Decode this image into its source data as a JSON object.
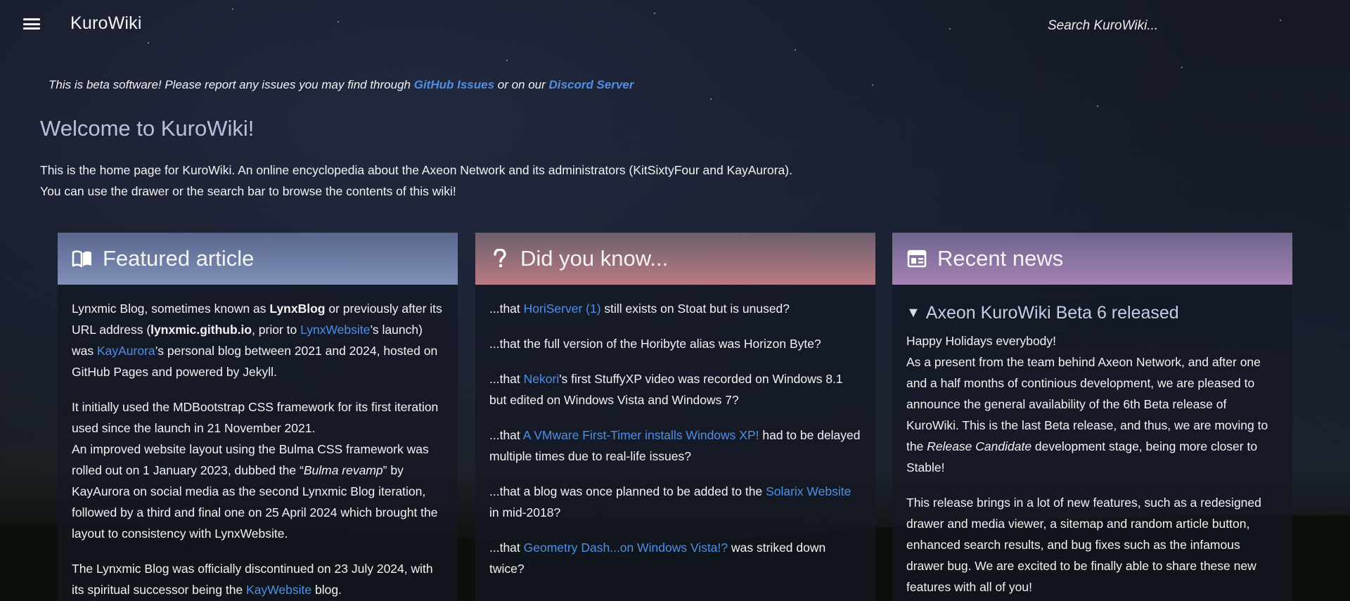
{
  "header": {
    "site_title": "KuroWiki",
    "search_placeholder": "Search KuroWiki..."
  },
  "beta_note": {
    "text_before": "This is beta software! Please report any issues you may find through ",
    "link1": "GitHub Issues",
    "text_middle": " or on our ",
    "link2": "Discord Server"
  },
  "welcome": {
    "title": "Welcome to KuroWiki!",
    "line1": "This is the home page for KuroWiki. An online encyclopedia about the Axeon Network and its administrators (KitSixtyFour and KayAurora).",
    "line2": "You can use the drawer or the search bar to browse the contents of this wiki!"
  },
  "featured": {
    "title": "Featured article",
    "icon": "book-open-icon",
    "p1": {
      "a": "Lynxmic Blog, sometimes known as ",
      "b_bold": "LynxBlog",
      "c": " or previously after its URL address (",
      "d_bold": "lynxmic.github.io",
      "e": ", prior to ",
      "f_link": "LynxWebsite",
      "g": "’s launch) was ",
      "h_link": "KayAurora",
      "i": "’s personal blog between 2021 and 2024, hosted on GitHub Pages and powered by Jekyll."
    },
    "p2": {
      "a": "It initially used the MDBootstrap CSS framework for its first iteration used since the launch in 21 November 2021.",
      "b": "An improved website layout using the Bulma CSS framework was rolled out on 1 January 2023, dubbed the “",
      "c_italic": "Bulma revamp",
      "d": "” by KayAurora on social media as the second Lynxmic Blog iteration, followed by a third and final one on 25 April 2024 which brought the layout to consistency with LynxWebsite."
    },
    "p3": {
      "a": "The Lynxmic Blog was officially discontinued on 23 July 2024, with its spiritual successor being the ",
      "b_link": "KayWebsite",
      "c": " blog."
    }
  },
  "didyouknow": {
    "title": "Did you know...",
    "icon": "question-mark-icon",
    "items": [
      {
        "pre": "...that ",
        "link": "HoriServer (1)",
        "post": " still exists on Stoat but is unused?"
      },
      {
        "pre": "...that the full version of the Horibyte alias was Horizon Byte?",
        "link": "",
        "post": ""
      },
      {
        "pre": "...that ",
        "link": "Nekori",
        "post": "'s first StuffyXP video was recorded on Windows 8.1 but edited on Windows Vista and Windows 7?"
      },
      {
        "pre": "...that ",
        "link": "A VMware First-Timer installs Windows XP!",
        "post": " had to be delayed multiple times due to real-life issues?"
      },
      {
        "pre": "...that a blog was once planned to be added to the ",
        "link": "Solarix Website",
        "post": " in mid-2018?"
      },
      {
        "pre": "...that ",
        "link": "Geometry Dash...on Windows Vista!?",
        "post": " was striked down twice?"
      }
    ]
  },
  "news": {
    "title": "Recent news",
    "icon": "newspaper-icon",
    "item_title": "Axeon KuroWiki Beta 6 released",
    "toggle_icon": "triangle-down-icon",
    "greeting": "Happy Holidays everybody!",
    "p1": {
      "a": "As a present from the team behind Axeon Network, and after one and a half months of continious development, we are pleased to announce the general availability of the 6th Beta release of KuroWiki. This is the last Beta release, and thus, we are moving to the ",
      "b_italic": "Release Candidate",
      "c": " development stage, being more closer to Stable!"
    },
    "p2": "This release brings in a lot of new features, such as a redesigned drawer and media viewer, a sitemap and random article button, enhanced search results, and bug fixes such as the infamous drawer bug. We are excited to be finally able to share these new features with all of you!"
  },
  "colors": {
    "link": "#4f8fe6",
    "welcome_title": "#b8c0de",
    "featured_header": "#7f8fb6",
    "didyouknow_header": "#b97b84",
    "news_header": "#a583b4"
  }
}
